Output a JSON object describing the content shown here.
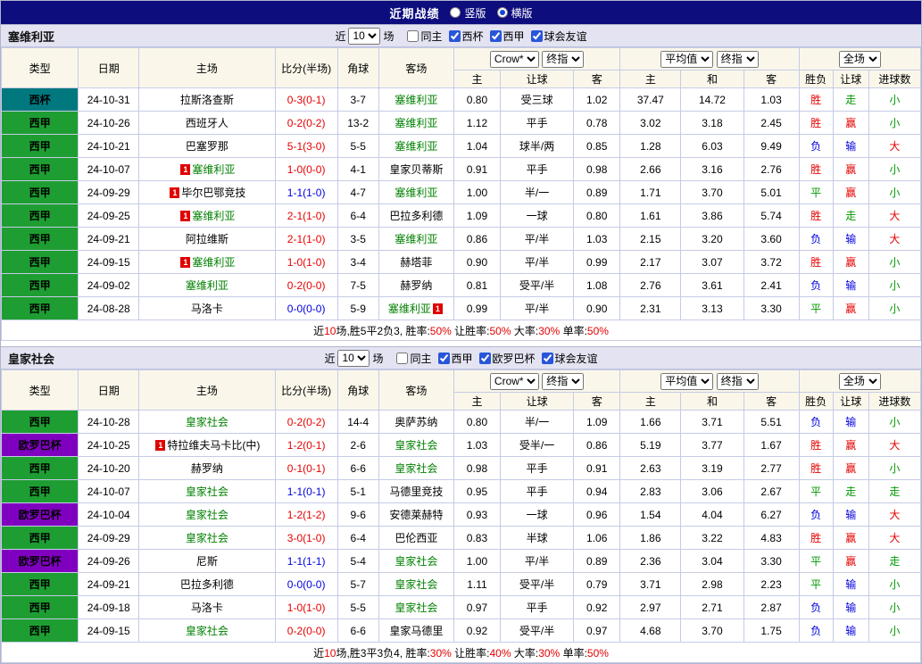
{
  "titlebar": {
    "title": "近期战绩",
    "radios": [
      {
        "label": "竖版",
        "selected": false
      },
      {
        "label": "横版",
        "selected": true
      }
    ]
  },
  "palette": {
    "red": "#e60000",
    "green": "#009900",
    "blue": "#0000e0",
    "self_green": "#008000",
    "navy": "#0d0d7e"
  },
  "league_colors": {
    "西杯": "#00787e",
    "西甲": "#1e9e32",
    "欧罗巴杯": "#8000c0"
  },
  "sections": [
    {
      "team": "塞维利亚",
      "filter": {
        "near_label": "近",
        "count": "10",
        "games_label": "场",
        "same_home": {
          "label": "同主",
          "checked": false
        },
        "leagues": [
          {
            "label": "西杯",
            "checked": true
          },
          {
            "label": "西甲",
            "checked": true
          },
          {
            "label": "球会友谊",
            "checked": true
          }
        ]
      },
      "header": {
        "type": "类型",
        "date": "日期",
        "home": "主场",
        "score": "比分(半场)",
        "corner": "角球",
        "away": "客场",
        "odds_dropdowns": [
          "Crow*",
          "终指"
        ],
        "odds_cols": [
          "主",
          "让球",
          "客"
        ],
        "avg_dropdowns": [
          "平均值",
          "终指"
        ],
        "avg_cols": [
          "主",
          "和",
          "客"
        ],
        "full_dropdown": "全场",
        "result_cols": [
          "胜负",
          "让球",
          "进球数"
        ]
      },
      "rows": [
        {
          "league": "西杯",
          "date": "24-10-31",
          "home": {
            "name": "拉斯洛查斯"
          },
          "score": {
            "text": "0-3(0-1)",
            "color": "red"
          },
          "corner": "3-7",
          "away": {
            "name": "塞维利亚",
            "self": true
          },
          "odds": [
            "0.80",
            "受三球",
            "1.02"
          ],
          "avg": [
            "37.47",
            "14.72",
            "1.03"
          ],
          "results": [
            [
              "胜",
              "red"
            ],
            [
              "走",
              "green"
            ],
            [
              "小",
              "green"
            ]
          ]
        },
        {
          "league": "西甲",
          "date": "24-10-26",
          "home": {
            "name": "西班牙人"
          },
          "score": {
            "text": "0-2(0-2)",
            "color": "red"
          },
          "corner": "13-2",
          "away": {
            "name": "塞维利亚",
            "self": true
          },
          "odds": [
            "1.12",
            "平手",
            "0.78"
          ],
          "avg": [
            "3.02",
            "3.18",
            "2.45"
          ],
          "results": [
            [
              "胜",
              "red"
            ],
            [
              "赢",
              "red"
            ],
            [
              "小",
              "green"
            ]
          ]
        },
        {
          "league": "西甲",
          "date": "24-10-21",
          "home": {
            "name": "巴塞罗那"
          },
          "score": {
            "text": "5-1(3-0)",
            "color": "red"
          },
          "corner": "5-5",
          "away": {
            "name": "塞维利亚",
            "self": true
          },
          "odds": [
            "1.04",
            "球半/两",
            "0.85"
          ],
          "avg": [
            "1.28",
            "6.03",
            "9.49"
          ],
          "results": [
            [
              "负",
              "blue"
            ],
            [
              "输",
              "blue"
            ],
            [
              "大",
              "red"
            ]
          ]
        },
        {
          "league": "西甲",
          "date": "24-10-07",
          "home": {
            "name": "塞维利亚",
            "self": true,
            "card_before": "1"
          },
          "score": {
            "text": "1-0(0-0)",
            "color": "red"
          },
          "corner": "4-1",
          "away": {
            "name": "皇家贝蒂斯"
          },
          "odds": [
            "0.91",
            "平手",
            "0.98"
          ],
          "avg": [
            "2.66",
            "3.16",
            "2.76"
          ],
          "results": [
            [
              "胜",
              "red"
            ],
            [
              "赢",
              "red"
            ],
            [
              "小",
              "green"
            ]
          ]
        },
        {
          "league": "西甲",
          "date": "24-09-29",
          "home": {
            "name": "毕尔巴鄂竞技",
            "card_before": "1"
          },
          "score": {
            "text": "1-1(1-0)",
            "color": "blue"
          },
          "corner": "4-7",
          "away": {
            "name": "塞维利亚",
            "self": true
          },
          "odds": [
            "1.00",
            "半/一",
            "0.89"
          ],
          "avg": [
            "1.71",
            "3.70",
            "5.01"
          ],
          "results": [
            [
              "平",
              "green"
            ],
            [
              "赢",
              "red"
            ],
            [
              "小",
              "green"
            ]
          ]
        },
        {
          "league": "西甲",
          "date": "24-09-25",
          "home": {
            "name": "塞维利亚",
            "self": true,
            "card_before": "1"
          },
          "score": {
            "text": "2-1(1-0)",
            "color": "red"
          },
          "corner": "6-4",
          "away": {
            "name": "巴拉多利德"
          },
          "odds": [
            "1.09",
            "一球",
            "0.80"
          ],
          "avg": [
            "1.61",
            "3.86",
            "5.74"
          ],
          "results": [
            [
              "胜",
              "red"
            ],
            [
              "走",
              "green"
            ],
            [
              "大",
              "red"
            ]
          ]
        },
        {
          "league": "西甲",
          "date": "24-09-21",
          "home": {
            "name": "阿拉维斯"
          },
          "score": {
            "text": "2-1(1-0)",
            "color": "red"
          },
          "corner": "3-5",
          "away": {
            "name": "塞维利亚",
            "self": true
          },
          "odds": [
            "0.86",
            "平/半",
            "1.03"
          ],
          "avg": [
            "2.15",
            "3.20",
            "3.60"
          ],
          "results": [
            [
              "负",
              "blue"
            ],
            [
              "输",
              "blue"
            ],
            [
              "大",
              "red"
            ]
          ]
        },
        {
          "league": "西甲",
          "date": "24-09-15",
          "home": {
            "name": "塞维利亚",
            "self": true,
            "card_before": "1"
          },
          "score": {
            "text": "1-0(1-0)",
            "color": "red"
          },
          "corner": "3-4",
          "away": {
            "name": "赫塔菲"
          },
          "odds": [
            "0.90",
            "平/半",
            "0.99"
          ],
          "avg": [
            "2.17",
            "3.07",
            "3.72"
          ],
          "results": [
            [
              "胜",
              "red"
            ],
            [
              "赢",
              "red"
            ],
            [
              "小",
              "green"
            ]
          ]
        },
        {
          "league": "西甲",
          "date": "24-09-02",
          "home": {
            "name": "塞维利亚",
            "self": true
          },
          "score": {
            "text": "0-2(0-0)",
            "color": "red"
          },
          "corner": "7-5",
          "away": {
            "name": "赫罗纳"
          },
          "odds": [
            "0.81",
            "受平/半",
            "1.08"
          ],
          "avg": [
            "2.76",
            "3.61",
            "2.41"
          ],
          "results": [
            [
              "负",
              "blue"
            ],
            [
              "输",
              "blue"
            ],
            [
              "小",
              "green"
            ]
          ]
        },
        {
          "league": "西甲",
          "date": "24-08-28",
          "home": {
            "name": "马洛卡"
          },
          "score": {
            "text": "0-0(0-0)",
            "color": "blue"
          },
          "corner": "5-9",
          "away": {
            "name": "塞维利亚",
            "self": true,
            "card_after": "1"
          },
          "odds": [
            "0.99",
            "平/半",
            "0.90"
          ],
          "avg": [
            "2.31",
            "3.13",
            "3.30"
          ],
          "results": [
            [
              "平",
              "green"
            ],
            [
              "赢",
              "red"
            ],
            [
              "小",
              "green"
            ]
          ]
        }
      ],
      "summary": [
        {
          "t": "近"
        },
        {
          "t": "10",
          "c": "red"
        },
        {
          "t": "场,胜5平2负3, 胜率:"
        },
        {
          "t": "50%",
          "c": "red"
        },
        {
          "t": " 让胜率:"
        },
        {
          "t": "50%",
          "c": "red"
        },
        {
          "t": " 大率:"
        },
        {
          "t": "30%",
          "c": "red"
        },
        {
          "t": " 单率:"
        },
        {
          "t": "50%",
          "c": "red"
        }
      ]
    },
    {
      "team": "皇家社会",
      "filter": {
        "near_label": "近",
        "count": "10",
        "games_label": "场",
        "same_home": {
          "label": "同主",
          "checked": false
        },
        "leagues": [
          {
            "label": "西甲",
            "checked": true
          },
          {
            "label": "欧罗巴杯",
            "checked": true
          },
          {
            "label": "球会友谊",
            "checked": true
          }
        ]
      },
      "header": {
        "type": "类型",
        "date": "日期",
        "home": "主场",
        "score": "比分(半场)",
        "corner": "角球",
        "away": "客场",
        "odds_dropdowns": [
          "Crow*",
          "终指"
        ],
        "odds_cols": [
          "主",
          "让球",
          "客"
        ],
        "avg_dropdowns": [
          "平均值",
          "终指"
        ],
        "avg_cols": [
          "主",
          "和",
          "客"
        ],
        "full_dropdown": "全场",
        "result_cols": [
          "胜负",
          "让球",
          "进球数"
        ]
      },
      "rows": [
        {
          "league": "西甲",
          "date": "24-10-28",
          "home": {
            "name": "皇家社会",
            "self": true
          },
          "score": {
            "text": "0-2(0-2)",
            "color": "red"
          },
          "corner": "14-4",
          "away": {
            "name": "奥萨苏纳"
          },
          "odds": [
            "0.80",
            "半/一",
            "1.09"
          ],
          "avg": [
            "1.66",
            "3.71",
            "5.51"
          ],
          "results": [
            [
              "负",
              "blue"
            ],
            [
              "输",
              "blue"
            ],
            [
              "小",
              "green"
            ]
          ]
        },
        {
          "league": "欧罗巴杯",
          "date": "24-10-25",
          "home": {
            "name": "特拉维夫马卡比(中)",
            "card_before": "1"
          },
          "score": {
            "text": "1-2(0-1)",
            "color": "red"
          },
          "corner": "2-6",
          "away": {
            "name": "皇家社会",
            "self": true
          },
          "odds": [
            "1.03",
            "受半/一",
            "0.86"
          ],
          "avg": [
            "5.19",
            "3.77",
            "1.67"
          ],
          "results": [
            [
              "胜",
              "red"
            ],
            [
              "赢",
              "red"
            ],
            [
              "大",
              "red"
            ]
          ]
        },
        {
          "league": "西甲",
          "date": "24-10-20",
          "home": {
            "name": "赫罗纳"
          },
          "score": {
            "text": "0-1(0-1)",
            "color": "red"
          },
          "corner": "6-6",
          "away": {
            "name": "皇家社会",
            "self": true
          },
          "odds": [
            "0.98",
            "平手",
            "0.91"
          ],
          "avg": [
            "2.63",
            "3.19",
            "2.77"
          ],
          "results": [
            [
              "胜",
              "red"
            ],
            [
              "赢",
              "red"
            ],
            [
              "小",
              "green"
            ]
          ]
        },
        {
          "league": "西甲",
          "date": "24-10-07",
          "home": {
            "name": "皇家社会",
            "self": true
          },
          "score": {
            "text": "1-1(0-1)",
            "color": "blue"
          },
          "corner": "5-1",
          "away": {
            "name": "马德里竞技"
          },
          "odds": [
            "0.95",
            "平手",
            "0.94"
          ],
          "avg": [
            "2.83",
            "3.06",
            "2.67"
          ],
          "results": [
            [
              "平",
              "green"
            ],
            [
              "走",
              "green"
            ],
            [
              "走",
              "green"
            ]
          ]
        },
        {
          "league": "欧罗巴杯",
          "date": "24-10-04",
          "home": {
            "name": "皇家社会",
            "self": true
          },
          "score": {
            "text": "1-2(1-2)",
            "color": "red"
          },
          "corner": "9-6",
          "away": {
            "name": "安德莱赫特"
          },
          "odds": [
            "0.93",
            "一球",
            "0.96"
          ],
          "avg": [
            "1.54",
            "4.04",
            "6.27"
          ],
          "results": [
            [
              "负",
              "blue"
            ],
            [
              "输",
              "blue"
            ],
            [
              "大",
              "red"
            ]
          ]
        },
        {
          "league": "西甲",
          "date": "24-09-29",
          "home": {
            "name": "皇家社会",
            "self": true
          },
          "score": {
            "text": "3-0(1-0)",
            "color": "red"
          },
          "corner": "6-4",
          "away": {
            "name": "巴伦西亚"
          },
          "odds": [
            "0.83",
            "半球",
            "1.06"
          ],
          "avg": [
            "1.86",
            "3.22",
            "4.83"
          ],
          "results": [
            [
              "胜",
              "red"
            ],
            [
              "赢",
              "red"
            ],
            [
              "大",
              "red"
            ]
          ]
        },
        {
          "league": "欧罗巴杯",
          "date": "24-09-26",
          "home": {
            "name": "尼斯"
          },
          "score": {
            "text": "1-1(1-1)",
            "color": "blue"
          },
          "corner": "5-4",
          "away": {
            "name": "皇家社会",
            "self": true
          },
          "odds": [
            "1.00",
            "平/半",
            "0.89"
          ],
          "avg": [
            "2.36",
            "3.04",
            "3.30"
          ],
          "results": [
            [
              "平",
              "green"
            ],
            [
              "赢",
              "red"
            ],
            [
              "走",
              "green"
            ]
          ]
        },
        {
          "league": "西甲",
          "date": "24-09-21",
          "home": {
            "name": "巴拉多利德"
          },
          "score": {
            "text": "0-0(0-0)",
            "color": "blue"
          },
          "corner": "5-7",
          "away": {
            "name": "皇家社会",
            "self": true
          },
          "odds": [
            "1.11",
            "受平/半",
            "0.79"
          ],
          "avg": [
            "3.71",
            "2.98",
            "2.23"
          ],
          "results": [
            [
              "平",
              "green"
            ],
            [
              "输",
              "blue"
            ],
            [
              "小",
              "green"
            ]
          ]
        },
        {
          "league": "西甲",
          "date": "24-09-18",
          "home": {
            "name": "马洛卡"
          },
          "score": {
            "text": "1-0(1-0)",
            "color": "red"
          },
          "corner": "5-5",
          "away": {
            "name": "皇家社会",
            "self": true
          },
          "odds": [
            "0.97",
            "平手",
            "0.92"
          ],
          "avg": [
            "2.97",
            "2.71",
            "2.87"
          ],
          "results": [
            [
              "负",
              "blue"
            ],
            [
              "输",
              "blue"
            ],
            [
              "小",
              "green"
            ]
          ]
        },
        {
          "league": "西甲",
          "date": "24-09-15",
          "home": {
            "name": "皇家社会",
            "self": true
          },
          "score": {
            "text": "0-2(0-0)",
            "color": "red"
          },
          "corner": "6-6",
          "away": {
            "name": "皇家马德里"
          },
          "odds": [
            "0.92",
            "受平/半",
            "0.97"
          ],
          "avg": [
            "4.68",
            "3.70",
            "1.75"
          ],
          "results": [
            [
              "负",
              "blue"
            ],
            [
              "输",
              "blue"
            ],
            [
              "小",
              "green"
            ]
          ]
        }
      ],
      "summary": [
        {
          "t": "近"
        },
        {
          "t": "10",
          "c": "red"
        },
        {
          "t": "场,胜3平3负4, 胜率:"
        },
        {
          "t": "30%",
          "c": "red"
        },
        {
          "t": " 让胜率:"
        },
        {
          "t": "40%",
          "c": "red"
        },
        {
          "t": " 大率:"
        },
        {
          "t": "30%",
          "c": "red"
        },
        {
          "t": " 单率:"
        },
        {
          "t": "50%",
          "c": "red"
        }
      ]
    }
  ]
}
